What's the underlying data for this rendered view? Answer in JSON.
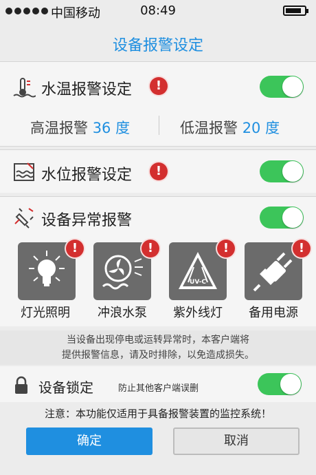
{
  "status": {
    "carrier": "中国移动",
    "time": "08:49",
    "battery_icon": "battery-icon"
  },
  "title": "设备报警设定",
  "water_temp": {
    "title": "水温报警设定",
    "enabled": true,
    "high_label": "高温报警",
    "high_value": "36",
    "low_label": "低温报警",
    "low_value": "20",
    "unit": "度"
  },
  "water_level": {
    "title": "水位报警设定",
    "enabled": true
  },
  "device_abnormal": {
    "title": "设备异常报警",
    "enabled": true,
    "devices": [
      {
        "label": "灯光照明",
        "icon": "light-bulb-icon"
      },
      {
        "label": "冲浪水泵",
        "icon": "wave-pump-icon"
      },
      {
        "label": "紫外线灯",
        "icon": "uv-lamp-icon",
        "badge": "UV-C"
      },
      {
        "label": "备用电源",
        "icon": "power-plug-icon"
      }
    ]
  },
  "notice": {
    "line1": "当设备出现停电或运转异常时，本客户端将",
    "line2": "提供报警信息，请及时排除，以免造成损失。"
  },
  "lock": {
    "title": "设备锁定",
    "subtitle": "防止其他客户端误删",
    "enabled": true
  },
  "warning": "注意：本功能仅适用于具备报警装置的监控系统！",
  "buttons": {
    "confirm": "确定",
    "cancel": "取消"
  },
  "colors": {
    "accent": "#1f8fe0",
    "toggle_on": "#3cc55a",
    "alert": "#d32f2f"
  }
}
